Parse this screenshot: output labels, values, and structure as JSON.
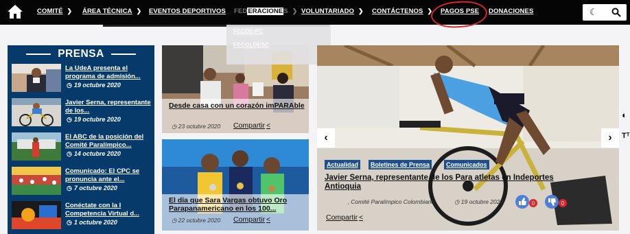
{
  "nav": {
    "items": [
      {
        "label": "COMITÉ",
        "chevron": true
      },
      {
        "label": "ÁREA TÉCNICA",
        "chevron": true
      },
      {
        "label": "EVENTOS DEPORTIVOS",
        "chevron": false
      },
      {
        "label_a": "FED",
        "label_b": "ERACIONE",
        "label_c": "S",
        "chevron": true
      },
      {
        "label": "VOLUNTARIADO",
        "chevron": true
      },
      {
        "label": "CONTÁCTENOS",
        "chevron": true
      },
      {
        "label": "PAGOS PSE",
        "chevron": false
      },
      {
        "label": "DONACIONES",
        "chevron": false
      }
    ],
    "submenu": [
      "FECDE-PC",
      "FECOLDESC"
    ],
    "home_icon": "home-icon",
    "theme_icon": "moon-icon",
    "search_icon": "search-icon",
    "annotation_color": "#d8262b"
  },
  "prensa": {
    "title": "PRENSA",
    "items": [
      {
        "title": "La UdeA presenta el programa de admisión...",
        "date": "19 octubre 2020"
      },
      {
        "title": "Javier Serna, representante de los...",
        "date": "19 octubre 2020"
      },
      {
        "title": "El ABC de la posición del Comité Paralímpico...",
        "date": "14 octubre 2020"
      },
      {
        "title": "Comunicado: El CPC se pronuncia ante el...",
        "date": "7 octubre 2020"
      },
      {
        "title": "Conéctate con la I Competencia Virtual d...",
        "date": "1 octubre 2020"
      }
    ]
  },
  "cards": [
    {
      "title": "Desde casa con un corazón imPARAble",
      "date": "23 octubre 2020",
      "share": "Compartir"
    },
    {
      "title": "El día que Sara Vargas obtuvo Oro Parapanamericano en los 100...",
      "date": "22 octubre 2020",
      "share": "Compartir"
    }
  ],
  "hero": {
    "tags": [
      "Actualidad",
      "Boletines de Prensa",
      "Comunicados"
    ],
    "title": "Javier Serna, representante de los Para atletas en Indeportes Antioquia",
    "author": "Comité Paralímpico Colombiano",
    "date": "19 octubre 2020",
    "share": "Compartir",
    "reaction_count_1": "0",
    "reaction_count_2": "0",
    "prev": "‹",
    "next": "›"
  },
  "colors": {
    "nav_bg": "#050505",
    "prensa_bg": "#063a6b",
    "tag_bg": "#1d4f8c"
  }
}
